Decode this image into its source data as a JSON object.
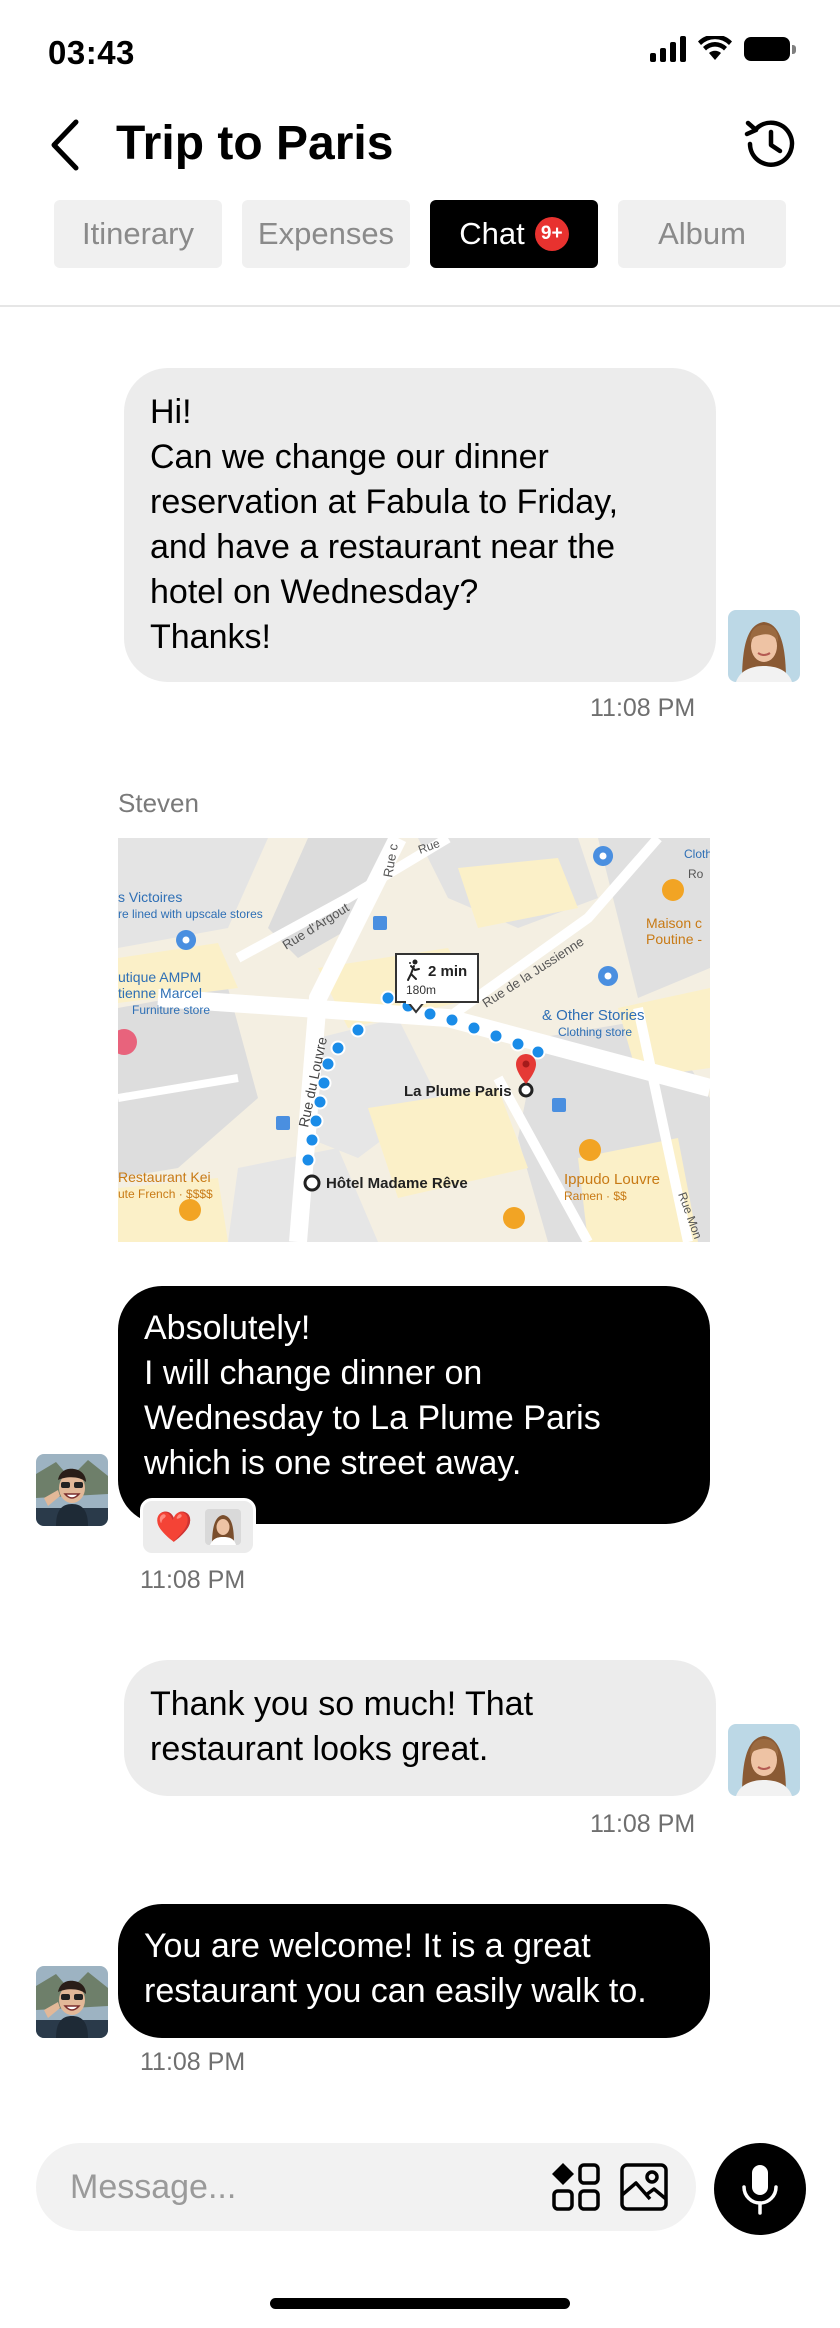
{
  "status_bar": {
    "time": "03:43"
  },
  "header": {
    "title": "Trip to Paris"
  },
  "tabs": [
    {
      "label": "Itinerary",
      "active": false
    },
    {
      "label": "Expenses",
      "active": false
    },
    {
      "label": "Chat",
      "active": true,
      "badge": "9+"
    },
    {
      "label": "Album",
      "active": false
    }
  ],
  "messages": [
    {
      "direction": "incoming",
      "lines": [
        "Hi!",
        "Can we change our dinner",
        "reservation at Fabula to Friday,",
        "and have a restaurant near the",
        "hotel on Wednesday?",
        "Thanks!"
      ],
      "time": "11:08 PM"
    },
    {
      "direction": "outgoing",
      "sender": "Steven",
      "map": {
        "walk_time": "2 min",
        "walk_distance": "180m",
        "destination": "La Plume Paris",
        "origin": "Hôtel Madame Rêve",
        "labels": {
          "victoires_1": "s Victoires",
          "victoires_2": "re lined with upscale stores",
          "ampm_1": "utique AMPM",
          "ampm_2": "tienne Marcel",
          "ampm_3": "Furniture store",
          "other_stories_1": "& Other Stories",
          "other_stories_2": "Clothing store",
          "maison_1": "Maison c",
          "maison_2": "Poutine -",
          "kei_1": "Restaurant Kei",
          "kei_2": "ute French · $$$$",
          "ippudo_1": "Ippudo Louvre",
          "ippudo_2": "Ramen · $$",
          "street_argout": "Rue d'Argout",
          "street_louvre": "Rue du Louvre",
          "street_jussienne": "Rue de la Jussienne",
          "street_rue": "Rue",
          "street_ro": "Ro",
          "street_mon": "Rue Mon",
          "street_c": "Rue c",
          "cloth": "Cloth"
        }
      },
      "lines": [
        "Absolutely!",
        "I will change dinner on",
        "Wednesday to La Plume Paris",
        "which  is one street away."
      ],
      "reaction": "❤️",
      "time": "11:08 PM"
    },
    {
      "direction": "incoming",
      "lines": [
        "Thank you so much!  That",
        "restaurant looks great."
      ],
      "time": "11:08 PM"
    },
    {
      "direction": "outgoing",
      "lines": [
        "You are welcome!  It is a great",
        "restaurant you can easily walk to."
      ],
      "time": "11:08 PM"
    }
  ],
  "composer": {
    "placeholder": "Message..."
  },
  "colors": {
    "badge": "#e8322f",
    "route": "#1a8ce8",
    "pin": "#e53935",
    "poi_blue": "#4a8fe0",
    "poi_orange": "#f2a424"
  }
}
